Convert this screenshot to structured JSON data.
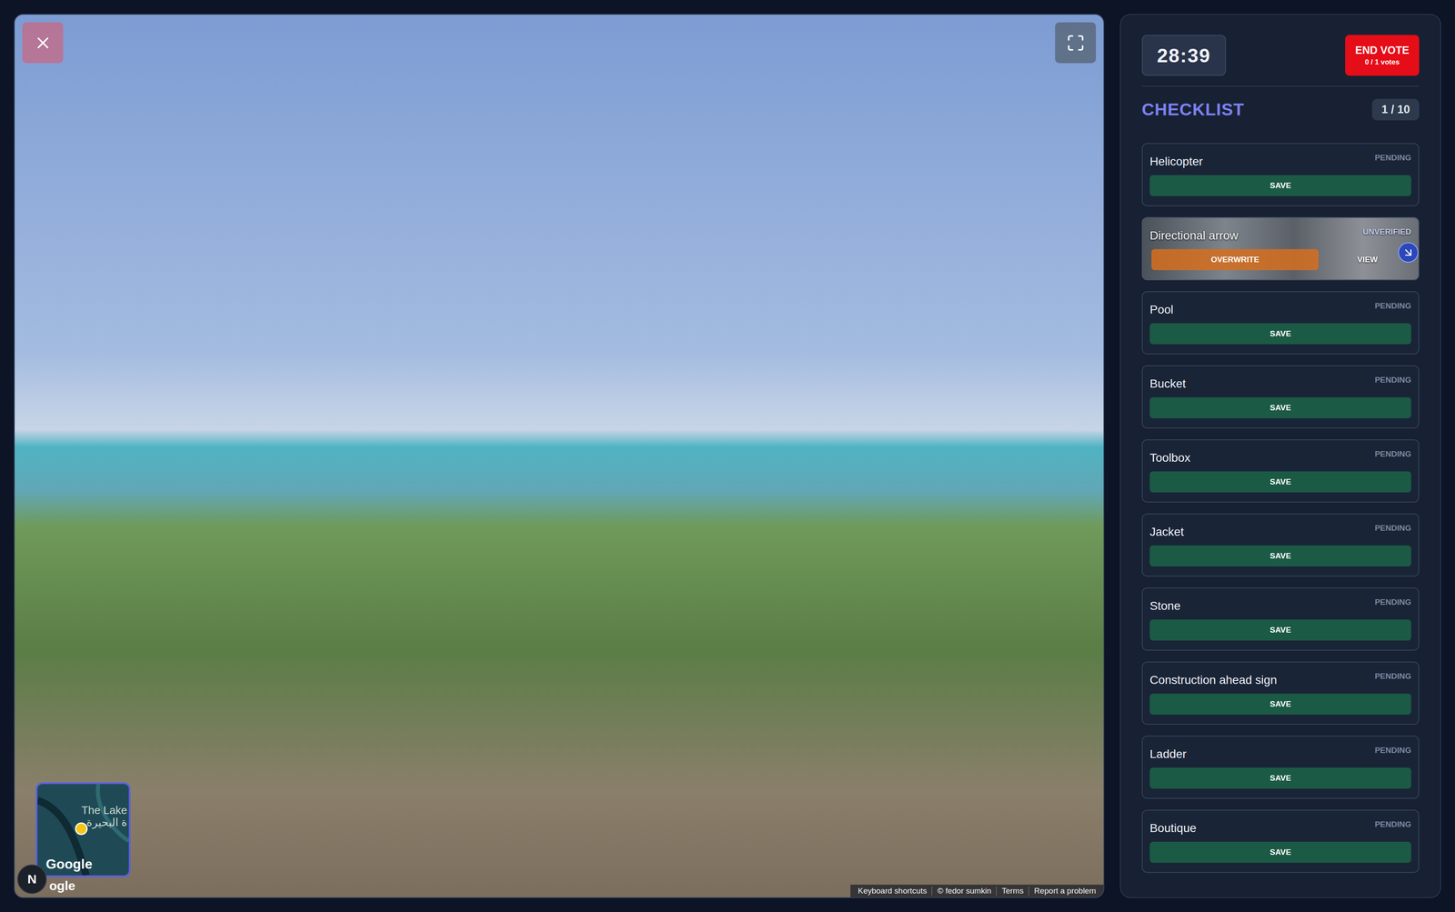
{
  "viewer": {
    "minimap": {
      "label": "The Lake",
      "label_ar": "ة البحيرة",
      "logo": "Google"
    },
    "compass": "N",
    "logo_partial": "ogle",
    "attribution": [
      "Keyboard shortcuts",
      "© fedor sumkin",
      "Terms",
      "Report a problem"
    ]
  },
  "sidebar": {
    "timer": "28:39",
    "end_vote": {
      "label": "END VOTE",
      "votes": "0 / 1 votes"
    },
    "checklist": {
      "title": "CHECKLIST",
      "count": "1 / 10",
      "items": [
        {
          "name": "Helicopter",
          "kind": "pending",
          "status": "PENDING",
          "actions": [
            {
              "label": "SAVE",
              "kind": "save"
            }
          ]
        },
        {
          "name": "Directional arrow",
          "kind": "captured",
          "status": "UNVERIFIED",
          "actions": [
            {
              "label": "OVERWRITE",
              "kind": "primary"
            },
            {
              "label": "VIEW",
              "kind": "link"
            }
          ]
        },
        {
          "name": "Pool",
          "kind": "pending",
          "status": "PENDING",
          "actions": [
            {
              "label": "SAVE",
              "kind": "save"
            }
          ]
        },
        {
          "name": "Bucket",
          "kind": "pending",
          "status": "PENDING",
          "actions": [
            {
              "label": "SAVE",
              "kind": "save"
            }
          ]
        },
        {
          "name": "Toolbox",
          "kind": "pending",
          "status": "PENDING",
          "actions": [
            {
              "label": "SAVE",
              "kind": "save"
            }
          ]
        },
        {
          "name": "Jacket",
          "kind": "pending",
          "status": "PENDING",
          "actions": [
            {
              "label": "SAVE",
              "kind": "save"
            }
          ]
        },
        {
          "name": "Stone",
          "kind": "pending",
          "status": "PENDING",
          "actions": [
            {
              "label": "SAVE",
              "kind": "save"
            }
          ]
        },
        {
          "name": "Construction ahead sign",
          "kind": "pending",
          "status": "PENDING",
          "actions": [
            {
              "label": "SAVE",
              "kind": "save"
            }
          ]
        },
        {
          "name": "Ladder",
          "kind": "pending",
          "status": "PENDING",
          "actions": [
            {
              "label": "SAVE",
              "kind": "save"
            }
          ]
        },
        {
          "name": "Boutique",
          "kind": "pending",
          "status": "PENDING",
          "actions": [
            {
              "label": "SAVE",
              "kind": "save"
            }
          ]
        }
      ]
    }
  }
}
